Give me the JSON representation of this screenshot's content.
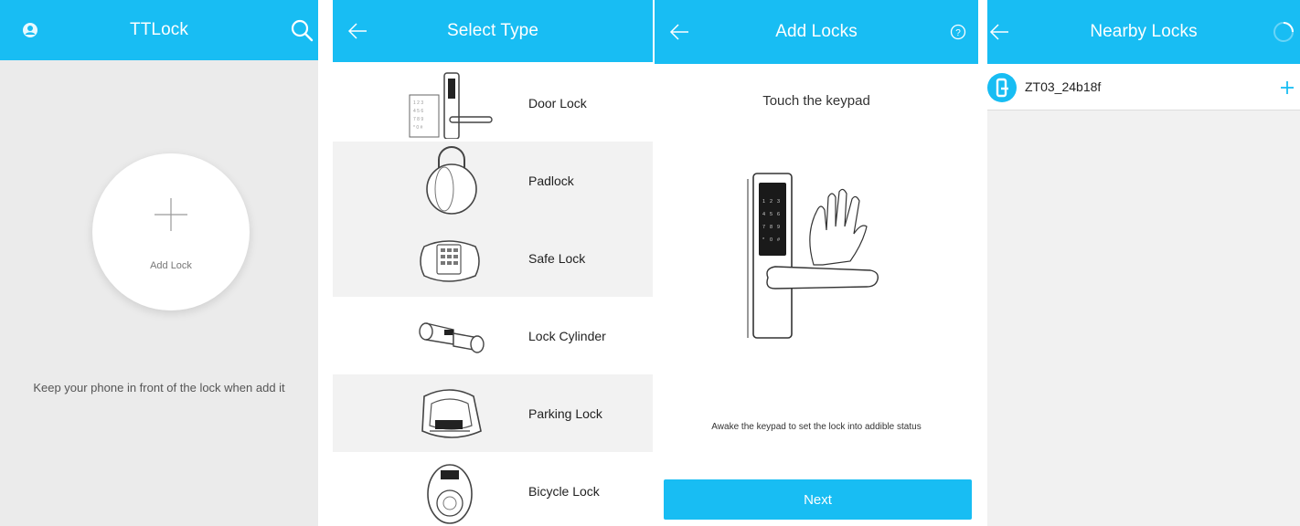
{
  "colors": {
    "accent": "#18bdf3",
    "panel_bg": "#ebebeb",
    "row_alt": "#f2f2f2"
  },
  "home": {
    "title": "TTLock",
    "left_icon": "user-icon",
    "right_icon": "search-icon",
    "add_lock_label": "Add Lock",
    "hint": "Keep your phone in front of the lock when add it"
  },
  "select_type": {
    "title": "Select Type",
    "back_icon": "back-arrow-icon",
    "types": [
      {
        "label": "Door Lock",
        "icon": "door-lock-icon"
      },
      {
        "label": "Padlock",
        "icon": "padlock-icon"
      },
      {
        "label": "Safe Lock",
        "icon": "safe-lock-icon"
      },
      {
        "label": "Lock Cylinder",
        "icon": "lock-cylinder-icon"
      },
      {
        "label": "Parking Lock",
        "icon": "parking-lock-icon"
      },
      {
        "label": "Bicycle Lock",
        "icon": "bicycle-lock-icon"
      }
    ]
  },
  "add_locks": {
    "title": "Add Locks",
    "back_icon": "back-arrow-icon",
    "help_icon": "help-icon",
    "instruction": "Touch the keypad",
    "hint": "Awake the keypad to set the lock into addible status",
    "next_label": "Next"
  },
  "nearby": {
    "title": "Nearby Locks",
    "back_icon": "back-arrow-icon",
    "status_icon": "loading-spinner-icon",
    "locks": [
      {
        "name": "ZT03_24b18f",
        "icon": "lock-icon",
        "action_icon": "add-icon"
      }
    ]
  }
}
